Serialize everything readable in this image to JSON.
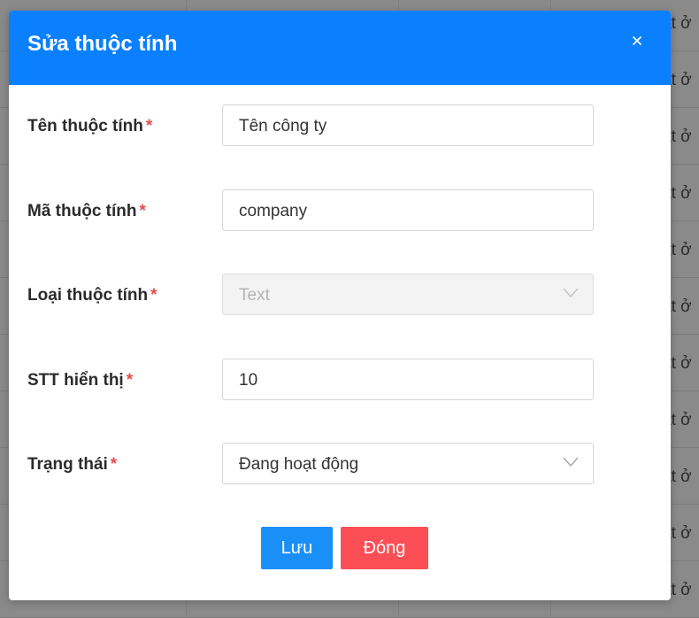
{
  "background": {
    "row_text": [
      "ạt ở",
      "ạt ở",
      "ạt ở",
      "ạt ở",
      "ạt ở",
      "ạt ở",
      "ạt ở",
      "ạt ở",
      "ạt ở",
      "ạt ở",
      "ạt ở"
    ]
  },
  "modal": {
    "title": "Sửa thuộc tính",
    "close_icon": "close-icon",
    "header_color": "#0a80ff"
  },
  "form": {
    "required_mark": "*",
    "fields": [
      {
        "label": "Tên thuộc tính",
        "value": "Tên công ty",
        "type": "text",
        "disabled": false
      },
      {
        "label": "Mã thuộc tính",
        "value": "company",
        "type": "text",
        "disabled": false
      },
      {
        "label": "Loại thuộc tính",
        "value": "Text",
        "type": "select",
        "disabled": true
      },
      {
        "label": "STT hiển thị",
        "value": "10",
        "type": "text",
        "disabled": false
      },
      {
        "label": "Trạng thái",
        "value": "Đang hoạt động",
        "type": "select",
        "disabled": false
      }
    ]
  },
  "actions": {
    "save_label": "Lưu",
    "close_label": "Đóng",
    "save_color": "#1b8ff8",
    "close_color": "#fb4f55"
  }
}
